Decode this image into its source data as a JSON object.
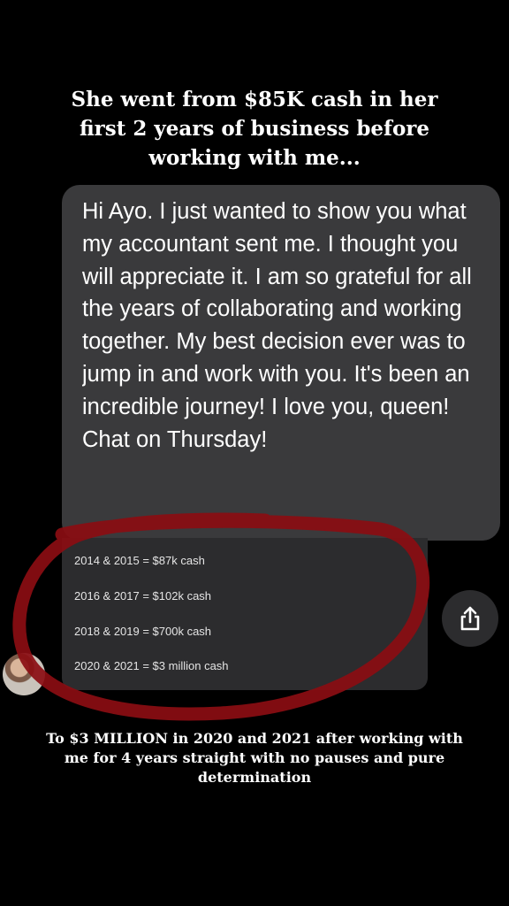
{
  "headline": {
    "line1": "She went from $85K cash in her",
    "line2": "first 2 years of business before",
    "line3": "working with me..."
  },
  "message": {
    "text": "Hi Ayo. I just wanted to show you what my accountant sent me. I thought you will appreciate it. I am so grateful for all the years of collaborating and working together. My best decision ever was to jump in and work with you. It's been an incredible journey! I love you, queen! Chat on Thursday!"
  },
  "attachment": {
    "lines": [
      "2014 & 2015 = $87k cash",
      "2016 & 2017 = $102k cash",
      "2018 & 2019 = $700k cash",
      "2020 & 2021 = $3 million cash"
    ]
  },
  "icons": {
    "share": "share-icon",
    "avatar": "sender-avatar"
  },
  "colors": {
    "background": "#000000",
    "bubble": "#3a3a3c",
    "attachment": "#2c2c2e",
    "highlight_circle": "#8b0d12"
  },
  "footer": {
    "line1": "To $3 MILLION in 2020 and 2021 after working with",
    "line2": "me for 4 years straight with no pauses and pure",
    "line3": "determination"
  }
}
